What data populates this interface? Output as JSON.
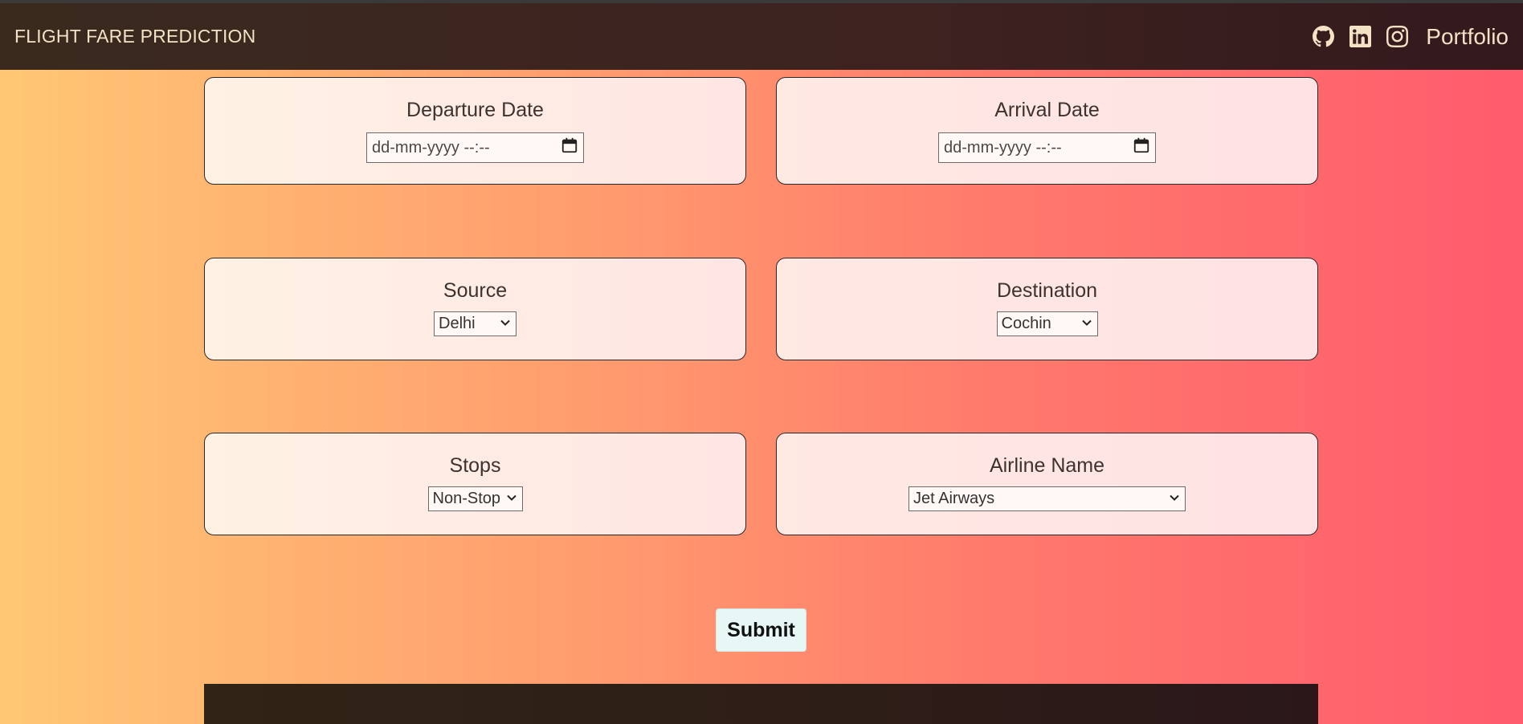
{
  "navbar": {
    "brand": "FLIGHT FARE PREDICTION",
    "icons": [
      "github-icon",
      "linkedin-icon",
      "instagram-icon"
    ],
    "portfolio_label": "Portfolio"
  },
  "form": {
    "departure": {
      "label": "Departure Date",
      "placeholder": "dd-mm-yyyy --:--"
    },
    "arrival": {
      "label": "Arrival Date",
      "placeholder": "dd-mm-yyyy --:--"
    },
    "source": {
      "label": "Source",
      "value": "Delhi"
    },
    "destination": {
      "label": "Destination",
      "value": "Cochin"
    },
    "stops": {
      "label": "Stops",
      "value": "Non-Stop"
    },
    "airline": {
      "label": "Airline Name",
      "value": "Jet Airways"
    },
    "submit_label": "Submit"
  },
  "colors": {
    "navbar_text": "#f3e2c4",
    "gradient_start": "#ffc774",
    "gradient_end": "#ff5b6d",
    "submit_bg": "#e6f7f5"
  }
}
